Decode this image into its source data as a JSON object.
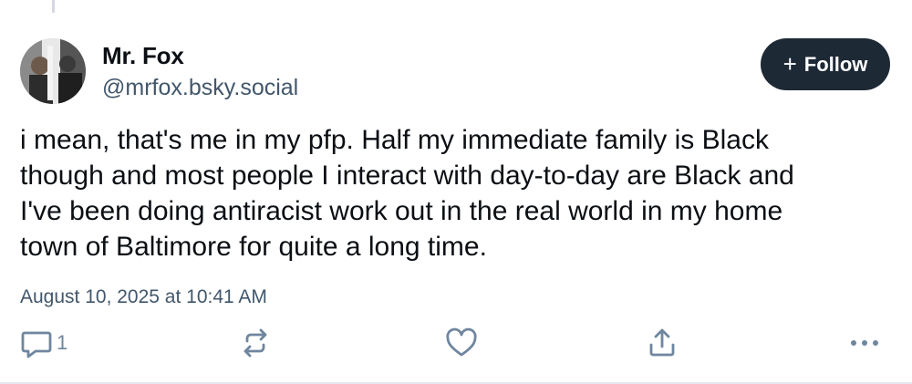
{
  "post": {
    "author": {
      "display_name": "Mr. Fox",
      "handle": "@mrfox.bsky.social"
    },
    "follow_button": {
      "icon": "plus-icon",
      "label": "Follow"
    },
    "text_lines": [
      "i mean, that's me in my pfp. Half my immediate family is Black",
      "though and most people I interact with day-to-day are Black and",
      "I've been doing antiracist work out in the real world in my home",
      "town of Baltimore for quite a long time."
    ],
    "timestamp": "August 10, 2025 at 10:41 AM",
    "actions": {
      "reply": {
        "icon": "reply-icon",
        "count": "1"
      },
      "repost": {
        "icon": "repost-icon"
      },
      "like": {
        "icon": "heart-icon"
      },
      "share": {
        "icon": "share-icon"
      },
      "more": {
        "icon": "more-icon"
      }
    }
  },
  "colors": {
    "text": "#0b0f14",
    "muted": "#42576c",
    "icon": "#6f869f",
    "follow_bg": "#1e2936",
    "follow_text": "#ffffff"
  }
}
